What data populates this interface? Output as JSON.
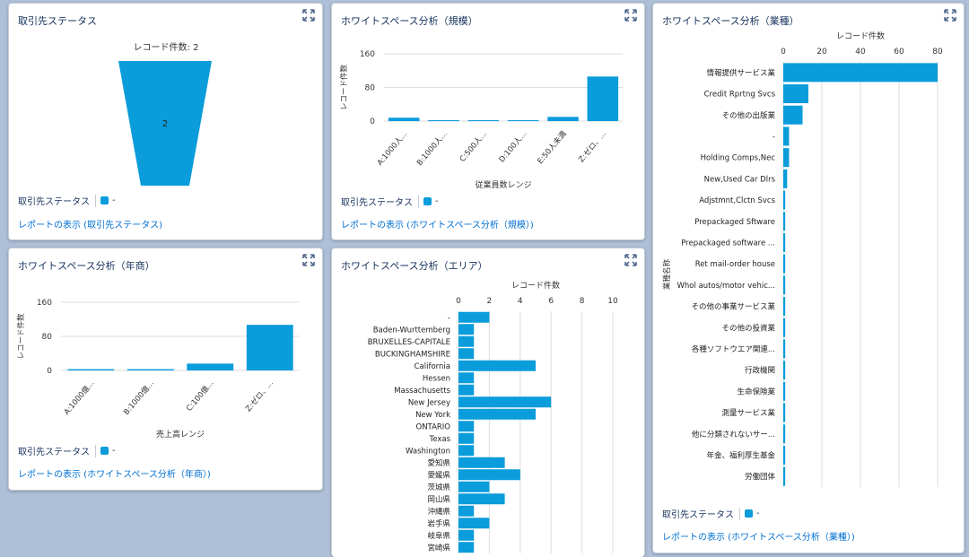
{
  "colors": {
    "bar": "#0a9cdb",
    "grid": "#dddddd",
    "text": "#16325c",
    "link": "#0070d2"
  },
  "icons": {
    "expand": "expand-icon"
  },
  "panels": {
    "status": {
      "title": "取引先ステータス",
      "legend_label": "取引先ステータス",
      "legend_item": "-",
      "link": "レポートの表示 (取引先ステータス)",
      "chart_data": {
        "type": "funnel",
        "title": "レコード件数: 2",
        "stages": [
          {
            "label": "-",
            "value": 2
          }
        ]
      }
    },
    "scale": {
      "title": "ホワイトスペース分析（規模）",
      "legend_label": "取引先ステータス",
      "legend_item": "-",
      "link": "レポートの表示 (ホワイトスペース分析（規模）)",
      "chart_data": {
        "type": "bar",
        "ylabel": "レコード件数",
        "xlabel": "従業員数レンジ",
        "yticks": [
          0,
          80,
          160
        ],
        "ylim": [
          0,
          160
        ],
        "categories": [
          "A:1000人...",
          "B:1000人...",
          "C:500人...",
          "D:100人...",
          "E:50人未満",
          "Z:ゼロ、..."
        ],
        "values": [
          8,
          1,
          1,
          2,
          10,
          106
        ]
      }
    },
    "revenue": {
      "title": "ホワイトスペース分析（年商）",
      "legend_label": "取引先ステータス",
      "legend_item": "-",
      "link": "レポートの表示 (ホワイトスペース分析（年商）)",
      "chart_data": {
        "type": "bar",
        "ylabel": "レコード件数",
        "xlabel": "売上高レンジ",
        "yticks": [
          0,
          80,
          160
        ],
        "ylim": [
          0,
          160
        ],
        "categories": [
          "A:1000億...",
          "B:1000億...",
          "C:100億...",
          "Z:ゼロ、..."
        ],
        "values": [
          3,
          3,
          16,
          107
        ]
      }
    },
    "area": {
      "title": "ホワイトスペース分析（エリア）",
      "chart_data": {
        "type": "bar",
        "orientation": "horizontal",
        "xlabel": "レコード件数",
        "xticks": [
          0,
          2,
          4,
          6,
          8,
          10
        ],
        "xlim": [
          0,
          10
        ],
        "categories": [
          "-",
          "Baden-Wurttemberg",
          "BRUXELLES-CAPITALE",
          "BUCKINGHAMSHIRE",
          "California",
          "Hessen",
          "Massachusetts",
          "New Jersey",
          "New York",
          "ONTARIO",
          "Texas",
          "Washington",
          "愛知県",
          "愛媛県",
          "茨城県",
          "岡山県",
          "沖縄県",
          "岩手県",
          "岐阜県",
          "宮崎県"
        ],
        "values": [
          2,
          1,
          1,
          1,
          5,
          1,
          1,
          6,
          5,
          1,
          1,
          1,
          3,
          4,
          2,
          3,
          1,
          2,
          1,
          1
        ]
      }
    },
    "industry": {
      "title": "ホワイトスペース分析（業種）",
      "legend_label": "取引先ステータス",
      "legend_item": "-",
      "link": "レポートの表示 (ホワイトスペース分析（業種）)",
      "chart_data": {
        "type": "bar",
        "orientation": "horizontal",
        "xlabel": "レコード件数",
        "ylabel": "業種名称",
        "xticks": [
          0,
          20,
          40,
          60,
          80
        ],
        "xlim": [
          0,
          80
        ],
        "categories": [
          "情報提供サービス業",
          "Credit Rprtng Svcs",
          "その他の出版業",
          "-",
          "Holding Comps,Nec",
          "New,Used Car Dlrs",
          "Adjstmnt,Clctn Svcs",
          "Prepackaged Sftware",
          "Prepackaged software ...",
          "Ret mail-order house",
          "Whol autos/motor vehic...",
          "その他の事業サービス業",
          "その他の投資業",
          "各種ソフトウエア関連...",
          "行政機関",
          "生命保険業",
          "測量サービス業",
          "他に分類されないサー...",
          "年金、福利厚生基金",
          "労働団体"
        ],
        "values": [
          80,
          13,
          10,
          3,
          3,
          2,
          1,
          1,
          1,
          1,
          1,
          1,
          1,
          1,
          1,
          1,
          1,
          1,
          1,
          1
        ]
      }
    }
  }
}
